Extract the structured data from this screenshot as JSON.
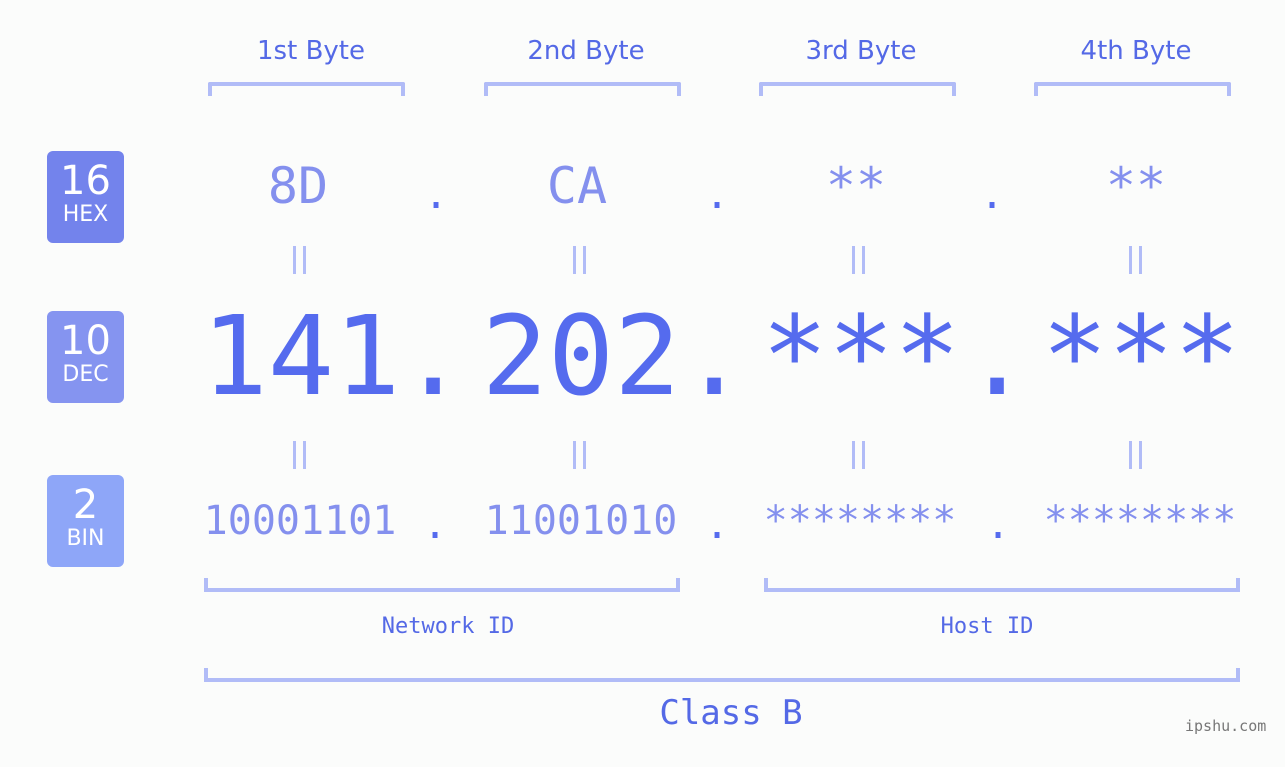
{
  "bytes": [
    {
      "label": "1st Byte",
      "hex": "8D",
      "dec": "141",
      "bin": "10001101"
    },
    {
      "label": "2nd Byte",
      "hex": "CA",
      "dec": "202",
      "bin": "11001010"
    },
    {
      "label": "3rd Byte",
      "hex": "**",
      "dec": "***",
      "bin": "********"
    },
    {
      "label": "4th Byte",
      "hex": "**",
      "dec": "***",
      "bin": "********"
    }
  ],
  "separator": ".",
  "equals": "=",
  "badges": {
    "hex": {
      "num": "16",
      "label": "HEX",
      "color": "#7383ec"
    },
    "dec": {
      "num": "10",
      "label": "DEC",
      "color": "#8594f0"
    },
    "bin": {
      "num": "2",
      "label": "BIN",
      "color": "#8ea6f8"
    }
  },
  "network_id_label": "Network ID",
  "host_id_label": "Host ID",
  "class_label": "Class B",
  "watermark": "ipshu.com",
  "colors": {
    "primary": "#5469e6",
    "light": "#8490ee",
    "bracket": "#b1bcf7"
  }
}
